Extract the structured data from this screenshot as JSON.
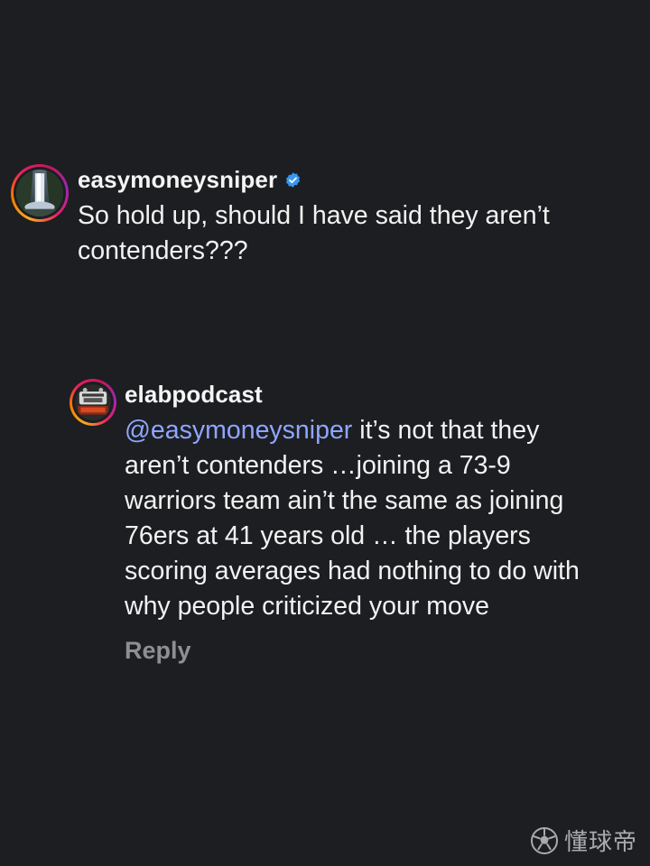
{
  "comments": [
    {
      "username": "easymoneysniper",
      "verified": true,
      "text": "So hold up, should I have said they aren’t contenders???"
    },
    {
      "username": "elabpodcast",
      "verified": false,
      "mention": "@easymoneysniper",
      "text": " it’s not that they aren’t contenders …joining a 73-9 warriors team ain’t the same as joining 76ers at 41 years old … the players scoring averages had nothing to do with why people criticized your move",
      "reply_label": "Reply"
    }
  ],
  "watermark": {
    "text": "懂球帝",
    "icon": "soccer-ball-icon"
  },
  "colors": {
    "background": "#1c1e21",
    "text": "#f2f2f2",
    "mention": "#8fa6ff",
    "reply": "#8d8f93",
    "verified": "#3897f0"
  }
}
